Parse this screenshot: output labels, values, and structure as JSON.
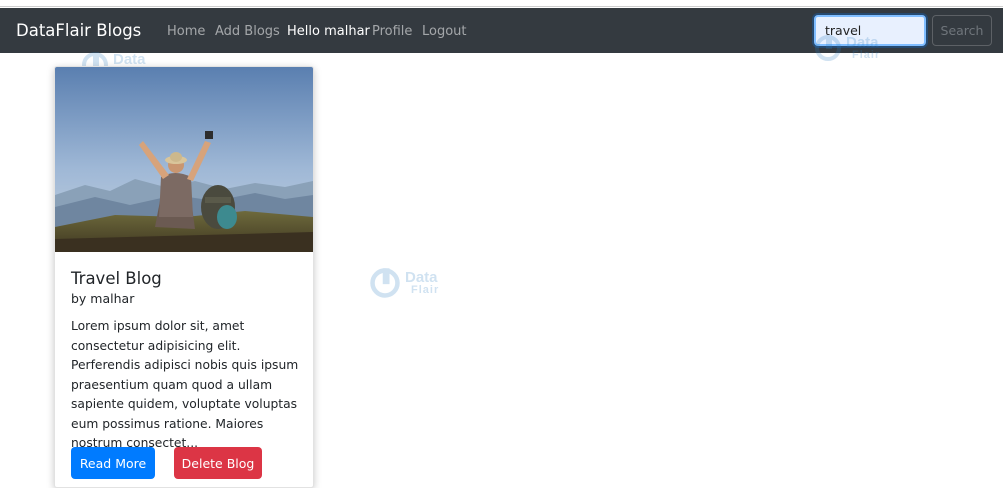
{
  "navbar": {
    "brand": "DataFlair Blogs",
    "links": [
      {
        "label": "Home"
      },
      {
        "label": "Add Blogs"
      },
      {
        "label": "Hello malhar"
      },
      {
        "label": "Profile"
      },
      {
        "label": "Logout"
      }
    ],
    "search": {
      "value": "travel",
      "button_label": "Search"
    }
  },
  "watermark": {
    "line1": "Data",
    "line2": "Flair"
  },
  "card": {
    "image_icon": "traveler-photo",
    "title": "Travel Blog",
    "author": "by malhar",
    "excerpt": "Lorem ipsum dolor sit, amet consectetur adipisicing elit. Perferendis adipisci nobis quis ipsum praesentium quam quod a ullam sapiente quidem, voluptate voluptas eum possimus ratione. Maiores nostrum consectet...",
    "read_more_label": "Read More",
    "delete_label": "Delete Blog"
  },
  "colors": {
    "navbar_bg": "#343a40",
    "primary": "#007bff",
    "danger": "#dc3545"
  }
}
